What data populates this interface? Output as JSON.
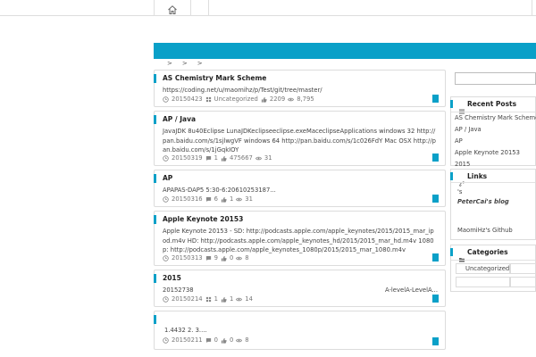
{
  "breadcrumb": {
    "separators": [
      ">",
      ">",
      ">"
    ]
  },
  "posts": [
    {
      "title": "AS Chemistry Mark Scheme",
      "body": "https://coding.net/u/maomihz/p/Test/git/tree/master/",
      "date": "20150423",
      "category": "Uncategorized",
      "likes": "2209",
      "views": "8,795"
    },
    {
      "title": "AP / Java",
      "body": "JavaJDK 8u40Eclipse LunaJDKeclipseeclipse.exeMaceclipseApplications windows 32 http://pan.baidu.com/s/1sjlwgVF windows 64 http://pan.baidu.com/s/1c026FdY Mac OSX http://pan.baidu.com/s/1jGqkIOY",
      "date": "20150319",
      "comments": "1",
      "likes": "475667",
      "views": "31"
    },
    {
      "title": "AP",
      "body": "APAPAS-DAP5  5:30-6:20610253187...",
      "date": "20150316",
      "comments": "6",
      "likes": "1",
      "views": "31"
    },
    {
      "title": "Apple Keynote 20153",
      "body": "Apple Keynote 20153 - SD: http://podcasts.apple.com/apple_keynotes/2015/2015_mar_ipod.m4v HD: http://podcasts.apple.com/apple_keynotes_hd/2015/2015_mar_hd.m4v 1080p: http://podcasts.apple.com/apple_keynotes_1080p/2015/2015_mar_1080.m4v",
      "date": "20150313",
      "comments": "9",
      "likes": "0",
      "views": "8"
    },
    {
      "title": "2015",
      "body": "20152738",
      "body_right": "A-levelA-LevelA...",
      "date": "20150214",
      "comments": "1",
      "likes": "1",
      "views": "14"
    },
    {
      "title": "",
      "body": "1.4432 2. 3....",
      "date": "20150211",
      "comments": "0",
      "likes": "0",
      "views": "8"
    }
  ],
  "sidebar": {
    "recent_posts": {
      "title": "Recent Posts",
      "items": [
        "AS Chemistry Mark Scheme",
        "AP / Java",
        "AP",
        "Apple Keynote 20153",
        "2015"
      ]
    },
    "links": {
      "title": "Links",
      "items": [
        "'s",
        "PeterCai's blog",
        "MaomiHz's Github"
      ]
    },
    "categories": {
      "title": "Categories",
      "items": [
        "Uncategorized"
      ]
    }
  },
  "colors": {
    "accent": "#0aa0c8",
    "border": "#dcdcdc"
  },
  "icons": {
    "home": "home-icon",
    "clock": "clock-icon",
    "comment": "comment-icon",
    "like": "thumb-up-icon",
    "views": "eye-icon"
  }
}
